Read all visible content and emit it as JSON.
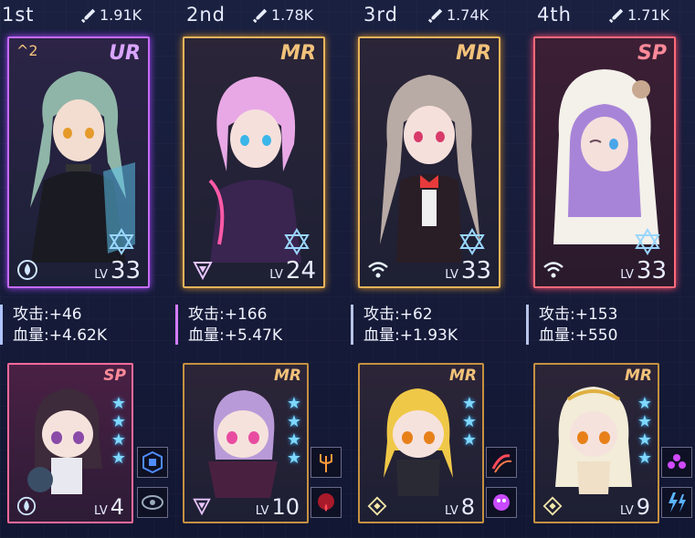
{
  "columns": [
    {
      "rank": "1st",
      "power": "1.91K",
      "rarity": "UR",
      "ascend": "2",
      "level_prefix": "LV",
      "level": "33",
      "attack_label": "攻击:",
      "attack": "+46",
      "hp_label": "血量:",
      "hp": "+4.62K",
      "sub_rarity": "SP",
      "sub_level": "4",
      "sub_stars": 4,
      "accent": "#c66bff"
    },
    {
      "rank": "2nd",
      "power": "1.78K",
      "rarity": "MR",
      "level_prefix": "LV",
      "level": "24",
      "attack_label": "攻击:",
      "attack": "+166",
      "hp_label": "血量:",
      "hp": "+5.47K",
      "sub_rarity": "MR",
      "sub_level": "10",
      "sub_stars": 4,
      "accent": "#e8b45a"
    },
    {
      "rank": "3rd",
      "power": "1.74K",
      "rarity": "MR",
      "level_prefix": "LV",
      "level": "33",
      "attack_label": "攻击:",
      "attack": "+62",
      "hp_label": "血量:",
      "hp": "+1.93K",
      "sub_rarity": "MR",
      "sub_level": "8",
      "sub_stars": 3,
      "accent": "#e8b45a"
    },
    {
      "rank": "4th",
      "power": "1.71K",
      "rarity": "SP",
      "level_prefix": "LV",
      "level": "33",
      "attack_label": "攻击:",
      "attack": "+153",
      "hp_label": "血量:",
      "hp": "+550",
      "sub_rarity": "MR",
      "sub_level": "9",
      "sub_stars": 4,
      "accent": "#ff6a7a"
    }
  ],
  "colors": {
    "star": "#7fd8ff",
    "ur": "#c66bff",
    "mr": "#e8b45a",
    "sp": "#ff6a7a"
  },
  "icons": {
    "power": "sword-icon",
    "class1": "drop-circle-icon",
    "class2": "triangle-icon",
    "class3": "wifi-icon",
    "class4": "wifi-icon",
    "element": "hexagram-icon"
  }
}
